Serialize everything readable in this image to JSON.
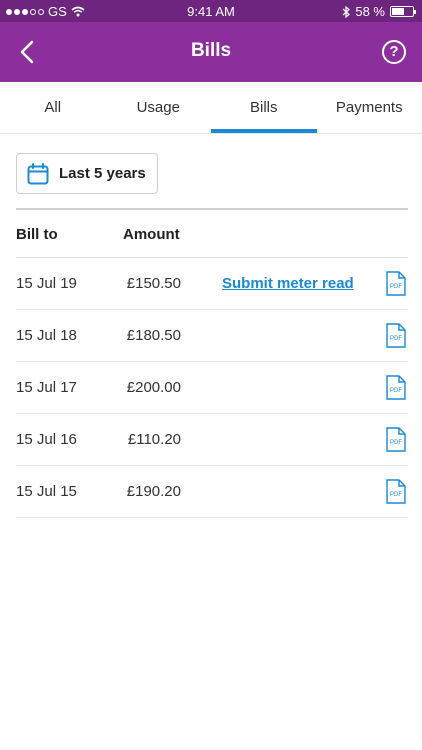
{
  "status_bar": {
    "carrier": "GS",
    "time": "9:41 AM",
    "battery": "58 %"
  },
  "header": {
    "title": "Bills"
  },
  "tabs": [
    {
      "label": "All"
    },
    {
      "label": "Usage"
    },
    {
      "label": "Bills",
      "active": true
    },
    {
      "label": "Payments"
    }
  ],
  "filter": {
    "label": "Last 5 years"
  },
  "table": {
    "headers": {
      "bill_to": "Bill to",
      "amount": "Amount"
    },
    "rows": [
      {
        "date": "15 Jul 19",
        "amount": "£150.50",
        "action": "Submit meter read"
      },
      {
        "date": "15 Jul 18",
        "amount": "£180.50",
        "action": ""
      },
      {
        "date": "15 Jul 17",
        "amount": "£200.00",
        "action": ""
      },
      {
        "date": "15 Jul 16",
        "amount": "£110.20",
        "action": ""
      },
      {
        "date": "15 Jul 15",
        "amount": "£190.20",
        "action": ""
      }
    ],
    "pdf_icon_text": "PDF"
  },
  "colors": {
    "header": "#8d2e9d",
    "status_bar": "#6e2580",
    "accent": "#1a8ad4"
  }
}
